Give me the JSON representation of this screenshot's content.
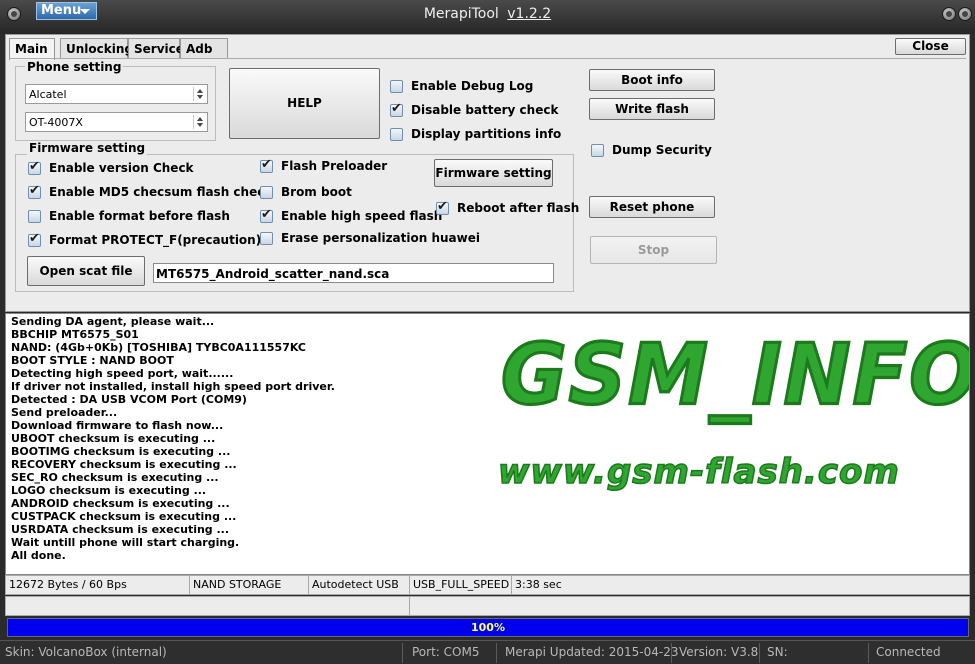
{
  "window": {
    "menu_label": "Menu",
    "title": "MerapiTool",
    "version": "v1.2.2"
  },
  "tabs": [
    {
      "label": "Main"
    },
    {
      "label": "Unlocking"
    },
    {
      "label": "Service"
    },
    {
      "label": "Adb"
    }
  ],
  "close_label": "Close",
  "phone_setting": {
    "title": "Phone setting",
    "brand": "Alcatel",
    "model": "OT-4007X"
  },
  "help_label": "HELP",
  "options": {
    "debug_log": {
      "label": "Enable Debug Log",
      "checked": false
    },
    "disable_battery": {
      "label": "Disable battery check",
      "checked": true
    },
    "display_partitions": {
      "label": "Display partitions info",
      "checked": false
    }
  },
  "right_buttons": {
    "boot_info": "Boot info",
    "write_flash": "Write flash",
    "reset_phone": "Reset phone",
    "stop": "Stop"
  },
  "dump_security": {
    "label": "Dump Security",
    "checked": false
  },
  "firmware_setting": {
    "title": "Firmware setting",
    "col1": [
      {
        "label": "Enable version Check",
        "checked": true
      },
      {
        "label": "Enable MD5 checsum flash check",
        "checked": true
      },
      {
        "label": "Enable format before flash",
        "checked": false
      },
      {
        "label": "Format PROTECT_F(precaution)",
        "checked": true
      }
    ],
    "col2": [
      {
        "label": "Flash Preloader",
        "checked": true
      },
      {
        "label": "Brom boot",
        "checked": false
      },
      {
        "label": "Enable high speed flash",
        "checked": true
      },
      {
        "label": "Erase personalization huawei",
        "checked": false
      }
    ],
    "firmware_button": "Firmware setting",
    "reboot_after_flash": {
      "label": "Reboot after flash",
      "checked": true
    },
    "open_scat_label": "Open scat file",
    "scat_file": "MT6575_Android_scatter_nand.sca"
  },
  "log": [
    "Sending DA agent, please wait...",
    "BBCHIP MT6575_S01",
    "NAND: (4Gb+0Kb) [TOSHIBA] TYBC0A111557KC",
    "BOOT STYLE : NAND BOOT",
    "Detecting high speed port, wait......",
    "If driver not installed, install high speed port driver.",
    "Detected : DA USB VCOM Port (COM9)",
    "Send preloader...",
    "Download firmware to flash now...",
    "UBOOT checksum is executing ...",
    "BOOTIMG checksum is executing ...",
    "RECOVERY checksum is executing ...",
    "SEC_RO checksum is executing ...",
    "LOGO checksum is executing ...",
    "ANDROID checksum is executing ...",
    "CUSTPACK checksum is executing ...",
    "USRDATA checksum is executing ...",
    "Wait untill phone will start charging.",
    "All done."
  ],
  "watermark": {
    "line1": "GSM_INFO",
    "line2": "www.gsm-flash.com"
  },
  "status": {
    "bytes": "12672 Bytes / 60 Bps",
    "storage": "NAND STORAGE",
    "usb": "Autodetect USB",
    "speed": "USB_FULL_SPEED",
    "time": "3:38 sec"
  },
  "progress": {
    "text": "100%",
    "value": 1.0
  },
  "bottom": {
    "skin": "Skin: VolcanoBox (internal)",
    "port": "Port: COM5",
    "updated": "Merapi Updated: 2015-04-23",
    "version": "Version: V3.8",
    "sn": "SN:",
    "connection": "Connected"
  }
}
